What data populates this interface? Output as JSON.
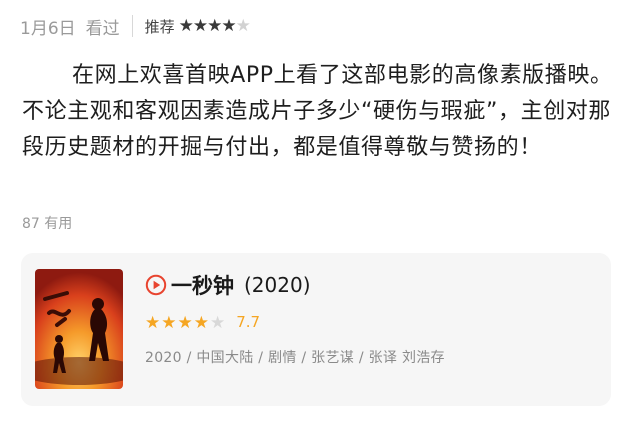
{
  "review_meta": {
    "date": "1月6日",
    "status": "看过",
    "recommend_label": "推荐",
    "stars_filled": 4,
    "stars_total": 5
  },
  "review": {
    "text": "在网上欢喜首映APP上看了这部电影的高像素版播映。不论主观和客观因素造成片子多少“硬伤与瑕疵”，主创对那段历史题材的开掘与付出，都是值得尊敬与赞扬的！"
  },
  "useful": {
    "count": "87",
    "label": "有用"
  },
  "movie": {
    "title": "一秒钟",
    "year": "(2020)",
    "score": "7.7",
    "stars_filled": 4,
    "stars_total": 5,
    "details": "2020 / 中国大陆 / 剧情 / 张艺谋 / 张译 刘浩存",
    "play_icon": "play-circle-icon",
    "accent_color": "#e8442f",
    "star_color": "#f5a623"
  }
}
